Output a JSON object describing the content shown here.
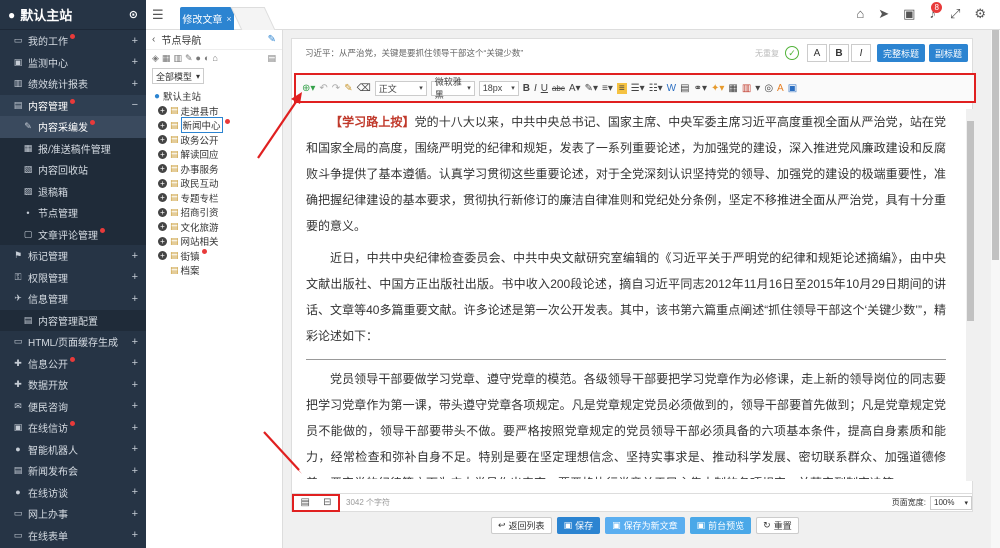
{
  "sidebar": {
    "title": "默认主站",
    "items": [
      {
        "label": "我的工作",
        "icon": "monitor-icon",
        "dot": true,
        "expand": "+"
      },
      {
        "label": "监测中心",
        "icon": "screen-icon",
        "dot": false,
        "expand": "+"
      },
      {
        "label": "绩效统计报表",
        "icon": "chart-icon",
        "dot": false,
        "expand": "+"
      },
      {
        "label": "内容管理",
        "icon": "doc-icon",
        "dot": true,
        "expand": "−",
        "open": true
      },
      {
        "label": "内容采编发",
        "icon": "edit-icon",
        "dot": true,
        "sub": true,
        "active": true
      },
      {
        "label": "报/准送稿件管理",
        "icon": "list-icon",
        "dot": false,
        "sub": true
      },
      {
        "label": "内容回收站",
        "icon": "bin-icon",
        "dot": false,
        "sub": true
      },
      {
        "label": "退稿箱",
        "icon": "box-icon",
        "dot": false,
        "sub": true
      },
      {
        "label": "节点管理",
        "icon": "node-icon",
        "dot": false,
        "sub": true
      },
      {
        "label": "文章评论管理",
        "icon": "comment-icon",
        "dot": true,
        "sub": true
      },
      {
        "label": "标记管理",
        "icon": "flag-icon",
        "dot": false,
        "expand": "+"
      },
      {
        "label": "权限管理",
        "icon": "key-icon",
        "dot": false,
        "expand": "+"
      },
      {
        "label": "信息管理",
        "icon": "wrench-icon",
        "dot": false,
        "expand": "+"
      },
      {
        "label": "内容管理配置",
        "icon": "setting-icon",
        "dot": false,
        "sub": true
      },
      {
        "label": "HTML/页面缓存生成",
        "icon": "html-icon",
        "dot": false,
        "expand": "+"
      },
      {
        "label": "信息公开",
        "icon": "info-icon",
        "dot": true,
        "expand": "+"
      },
      {
        "label": "数据开放",
        "icon": "data-icon",
        "dot": false,
        "expand": "+"
      },
      {
        "label": "便民咨询",
        "icon": "mail-icon",
        "dot": false,
        "expand": "+"
      },
      {
        "label": "在线信访",
        "icon": "inbox-icon",
        "dot": true,
        "expand": "+"
      },
      {
        "label": "智能机器人",
        "icon": "robot-icon",
        "dot": false,
        "expand": "+"
      },
      {
        "label": "新闻发布会",
        "icon": "news-icon",
        "dot": false,
        "expand": "+"
      },
      {
        "label": "在线访谈",
        "icon": "mic-icon",
        "dot": false,
        "expand": "+"
      },
      {
        "label": "网上办事",
        "icon": "office-icon",
        "dot": false,
        "expand": "+"
      },
      {
        "label": "在线表单",
        "icon": "form-icon",
        "dot": false,
        "expand": "+"
      }
    ]
  },
  "topbar": {
    "tab_label": "修改文章",
    "tab_close": "×",
    "badge": "8"
  },
  "tree": {
    "title": "节点导航",
    "model_select": "全部模型",
    "root": "默认主站",
    "nodes": [
      {
        "label": "走进县市",
        "pm": "+",
        "icon": "▤"
      },
      {
        "label": "新闻中心",
        "pm": "+",
        "icon": "▤",
        "highlight": true,
        "dot": true
      },
      {
        "label": "政务公开",
        "pm": "+",
        "icon": "▤"
      },
      {
        "label": "解读回应",
        "pm": "+",
        "icon": "▤"
      },
      {
        "label": "办事服务",
        "pm": "+",
        "icon": "▤"
      },
      {
        "label": "政民互动",
        "pm": "+",
        "icon": "▤"
      },
      {
        "label": "专题专栏",
        "pm": "+",
        "icon": "▤"
      },
      {
        "label": "招商引资",
        "pm": "+",
        "icon": "▤"
      },
      {
        "label": "文化旅游",
        "pm": "+",
        "icon": "▤"
      },
      {
        "label": "网站相关",
        "pm": "+",
        "icon": "▤"
      },
      {
        "label": "街镇",
        "pm": "+",
        "icon": "▤",
        "dot": true
      },
      {
        "label": "档案",
        "pm": "",
        "icon": "▤"
      }
    ]
  },
  "editor": {
    "title_value": "习近平：从严治党，关键是要抓住领导干部这个“关键少数”",
    "title_count": "无重复",
    "headline_btn": "完整标题",
    "subtitle_btn": "副标题",
    "toolbar": {
      "style": "正文",
      "font": "微软雅黑",
      "size": "18px",
      "bold": "B",
      "italic": "I",
      "underline": "U",
      "strike": "abc"
    },
    "para1_lead": "【学习路上按】",
    "para1": "党的十八大以来，中共中央总书记、国家主席、中央军委主席习近平高度重视全面从严治党，站在党和国家全局的高度，围绕严明党的纪律和规矩，发表了一系列重要论述，为加强党的建设，深入推进党风廉政建设和反腐败斗争提供了基本遵循。认真学习贯彻这些重要论述，对于全党深刻认识坚持党的领导、加强党的建设的极端重要性，准确把握纪律建设的基本要求，贯彻执行新修订的廉洁自律准则和党纪处分条例，坚定不移推进全面从严治党，具有十分重要的意义。",
    "para2": "近日，中共中央纪律检查委员会、中共中央文献研究室编辑的《习近平关于严明党的纪律和规矩论述摘编》，由中央文献出版社、中国方正出版社出版。书中收入200段论述，摘自习近平同志2012年11月16日至2015年10月29日期间的讲话、文章等40多篇重要文献。许多论述是第一次公开发表。其中，该书第六篇重点阐述“抓住领导干部这个‘关键少数’”，精彩论述如下：",
    "para3": "党员领导干部要做学习党章、遵守党章的模范。各级领导干部要把学习党章作为必修课，走上新的领导岗位的同志要把学习党章作为第一课，带头遵守党章各项规定。凡是党章规定党员必须做到的，领导干部要首先做到；凡是党章规定党员不能做的，领导干部要带头不做。要严格按照党章规定的党员领导干部必须具备的六项基本条件，提高自身素质和能力，经常检查和弥补自身不足。特别是要在坚定理想信念、坚持实事求是、推动科学发展、密切联系群众、加强道德修养、严守党的纪律等方面为广大党员作出表率，要严格执行党章关于民主集中制的各项规定，并落实到制定决策、",
    "char_count": "3042 个字符",
    "zoom_label": "页面宽度:",
    "zoom_value": "100%"
  },
  "actions": {
    "back": "返回列表",
    "save": "保存",
    "save_new": "保存为新文章",
    "preview": "前台预览",
    "reset": "重置"
  }
}
